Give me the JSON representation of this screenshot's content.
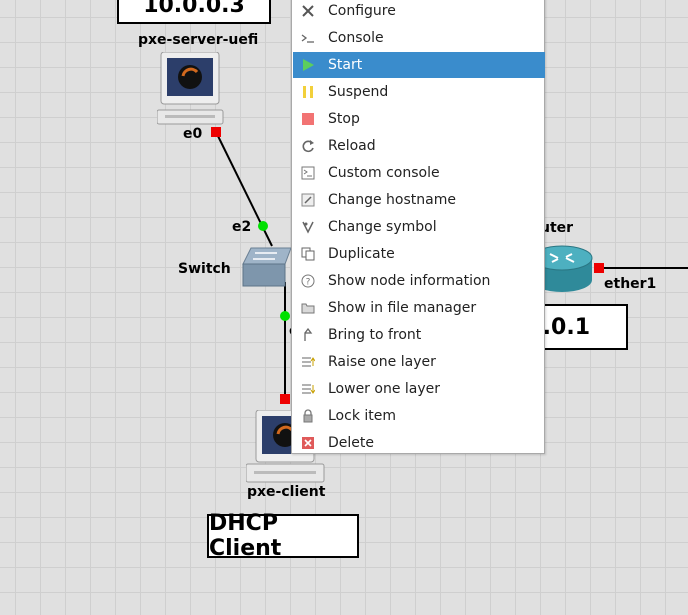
{
  "topology": {
    "server_label_box": "10.0.0.3",
    "server_node_name": "pxe-server-uefi",
    "server_port": "e0",
    "switch_name": "Switch",
    "switch_port_top": "e2",
    "switch_port_bottom_partial": "e",
    "router_name_partial": "uter",
    "router_port": "ether1",
    "router_label_box_partial": "0.0.1",
    "client_name": "pxe-client",
    "client_label_box": "DHCP Client"
  },
  "context_menu": {
    "highlighted": "Start",
    "items": [
      {
        "label": "Configure",
        "icon": "wrench-screwdriver-icon"
      },
      {
        "label": "Console",
        "icon": "terminal-prompt-icon"
      },
      {
        "label": "Start",
        "icon": "play-icon"
      },
      {
        "label": "Suspend",
        "icon": "pause-icon"
      },
      {
        "label": "Stop",
        "icon": "stop-icon"
      },
      {
        "label": "Reload",
        "icon": "reload-icon"
      },
      {
        "label": "Custom console",
        "icon": "custom-console-icon"
      },
      {
        "label": "Change hostname",
        "icon": "hostname-icon"
      },
      {
        "label": "Change symbol",
        "icon": "symbol-icon"
      },
      {
        "label": "Duplicate",
        "icon": "duplicate-icon"
      },
      {
        "label": "Show node information",
        "icon": "info-icon"
      },
      {
        "label": "Show in file manager",
        "icon": "folder-icon"
      },
      {
        "label": "Bring to front",
        "icon": "bring-front-icon"
      },
      {
        "label": "Raise one layer",
        "icon": "raise-layer-icon"
      },
      {
        "label": "Lower one layer",
        "icon": "lower-layer-icon"
      },
      {
        "label": "Lock item",
        "icon": "lock-icon"
      },
      {
        "label": "Delete",
        "icon": "delete-icon"
      }
    ]
  },
  "colors": {
    "link_up_port": "#00e000",
    "link_down_port": "#ee0000",
    "menu_highlight": "#3a8ccc"
  }
}
